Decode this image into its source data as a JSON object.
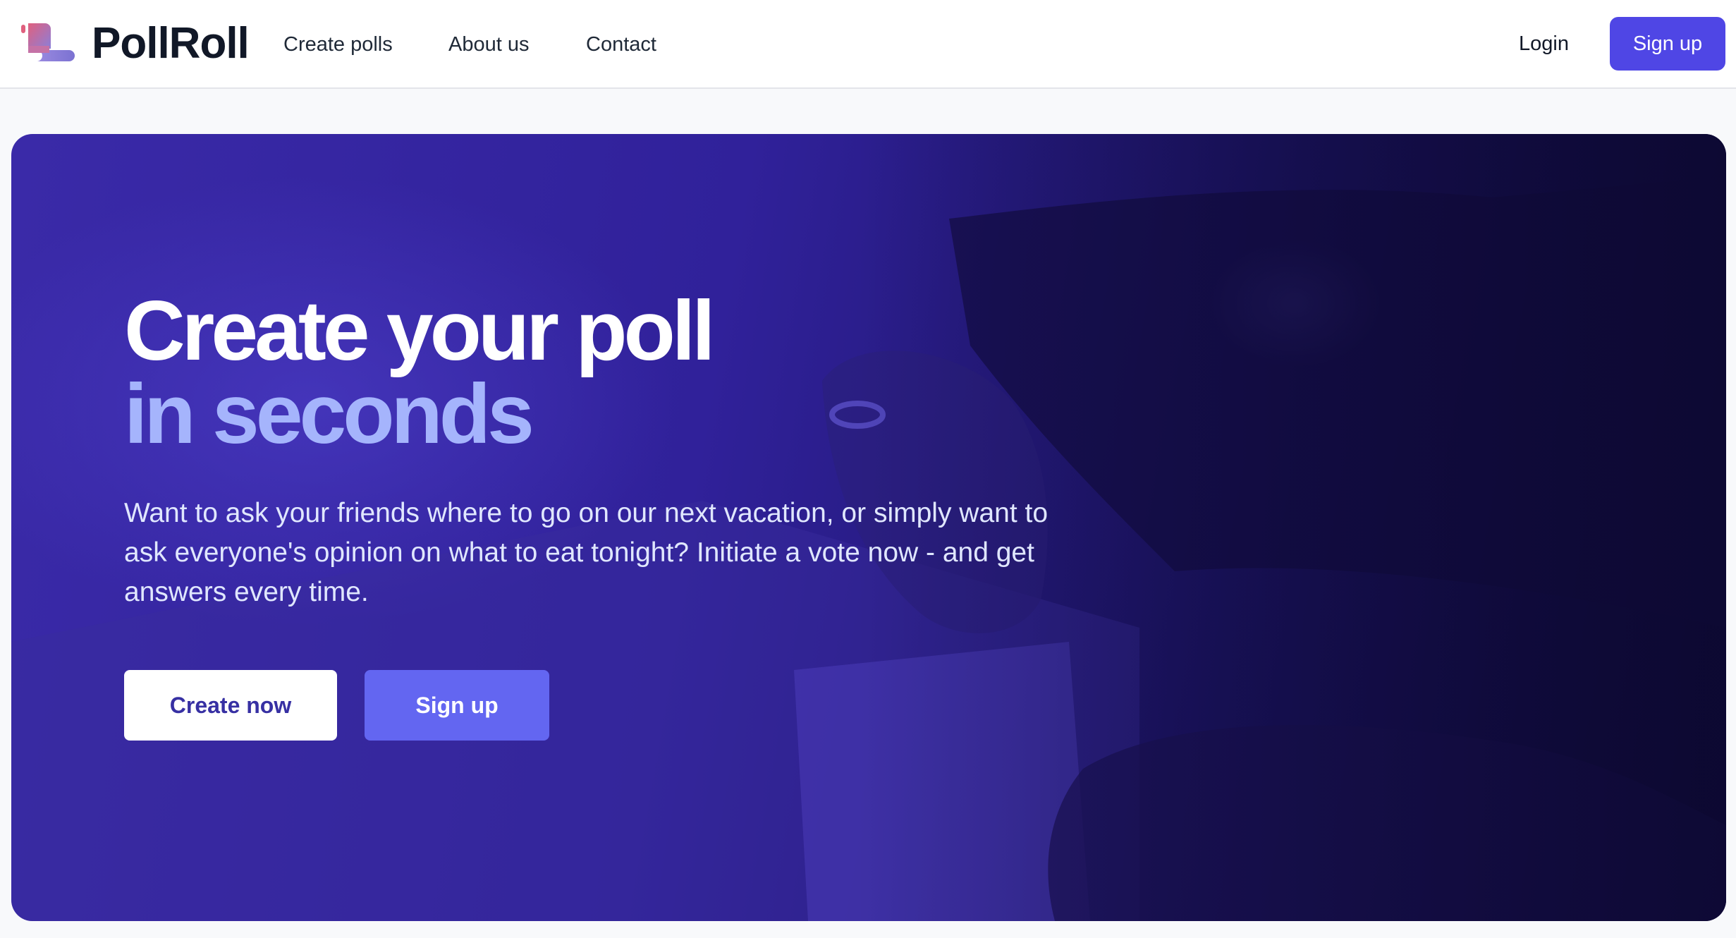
{
  "brand": {
    "name": "PollRoll",
    "logo_icon": "scroll-logo-icon"
  },
  "nav": {
    "links": [
      {
        "label": "Create polls"
      },
      {
        "label": "About us"
      },
      {
        "label": "Contact"
      }
    ],
    "login_label": "Login",
    "signup_label": "Sign up"
  },
  "hero": {
    "title_line1": "Create your poll",
    "title_line2": "in seconds",
    "description": "Want to ask your friends where to go on our next vacation, or simply want to ask everyone's opinion on what to eat tonight? Initiate a vote now - and get answers every time.",
    "primary_cta": "Create now",
    "secondary_cta": "Sign up",
    "background_image": "hand-dropping-ballot-into-box-photo"
  },
  "colors": {
    "accent": "#4f46e5",
    "accent_light": "#6366f1",
    "title_highlight": "#a5b4fc",
    "brand_text": "#111827"
  }
}
